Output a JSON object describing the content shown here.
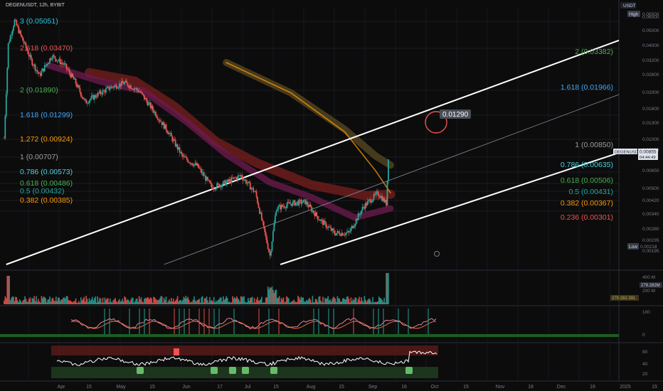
{
  "header": {
    "symbol_line": "DEGENUSDT, 12h, BYBIT",
    "currency": "USDT"
  },
  "price_scale": {
    "high_tag": "High",
    "high_value": "0.06500",
    "low_tag": "Low",
    "low_value": "0.00218",
    "current_symbol": "DEGENUSDT",
    "current_value": "0.00855",
    "countdown": "04:44:49",
    "ticks": [
      "0.06000",
      "0.05000",
      "0.04000",
      "0.03200",
      "0.02600",
      "0.02000",
      "0.01600",
      "0.01300",
      "0.01000",
      "0.00850",
      "0.00650",
      "0.00500",
      "0.00420",
      "0.00340",
      "0.00280",
      "0.00235",
      "0.00195"
    ]
  },
  "volume_scale": {
    "ticks": [
      "400 M",
      "200 M"
    ],
    "current_value": "279.282M",
    "left_value": "279.282.391"
  },
  "osc1_scale": {
    "ticks": [
      "100",
      "0"
    ]
  },
  "osc2_scale": {
    "ticks": [
      "80",
      "40",
      "20"
    ]
  },
  "time_axis": [
    "Apr",
    "15",
    "May",
    "15",
    "Jun",
    "17",
    "Jul",
    "15",
    "Aug",
    "15",
    "Sep",
    "16",
    "Oct",
    "15",
    "Nov",
    "18",
    "Dec",
    "16",
    "2025",
    "15"
  ],
  "fib_left": [
    {
      "label": "3 (0.05051)",
      "color": "#26c6da"
    },
    {
      "label": "2.618 (0.03470)",
      "color": "#ef5350"
    },
    {
      "label": "2 (0.01890)",
      "color": "#4caf50"
    },
    {
      "label": "1.618 (0.01299)",
      "color": "#42a5f5"
    },
    {
      "label": "1.272 (0.00924)",
      "color": "#ff9800"
    },
    {
      "label": "1 (0.00707)",
      "color": "#9e9e9e"
    },
    {
      "label": "0.786 (0.00573)",
      "color": "#4dd0e1"
    },
    {
      "label": "0.618 (0.00486)",
      "color": "#4caf50"
    },
    {
      "label": "0.5 (0.00432)",
      "color": "#26a69a"
    },
    {
      "label": "0.382 (0.00385)",
      "color": "#ff9800"
    }
  ],
  "fib_right": [
    {
      "label": "2 (0.03382)",
      "color": "#4caf50"
    },
    {
      "label": "1.618 (0.01966)",
      "color": "#42a5f5"
    },
    {
      "label": "1 (0.00850)",
      "color": "#9e9e9e"
    },
    {
      "label": "0.786 (0.00635)",
      "color": "#4dd0e1"
    },
    {
      "label": "0.618 (0.00506)",
      "color": "#4caf50"
    },
    {
      "label": "0.5 (0.00431)",
      "color": "#26a69a"
    },
    {
      "label": "0.382 (0.00367)",
      "color": "#ff9800"
    },
    {
      "label": "0.236 (0.00301)",
      "color": "#ef5350"
    }
  ],
  "annotation": {
    "label": "0.01290"
  },
  "chart_data": {
    "type": "candlestick",
    "symbol": "DEGENUSDT",
    "interval": "12h",
    "exchange": "BYBIT",
    "y_scale": "log",
    "ylim": [
      0.00195,
      0.065
    ],
    "x_range": [
      "2024-03-28",
      "2025-01-20"
    ],
    "price_path": [
      {
        "date": "2024-03-30",
        "close": 0.011
      },
      {
        "date": "2024-04-01",
        "close": 0.04
      },
      {
        "date": "2024-04-04",
        "close": 0.055
      },
      {
        "date": "2024-04-08",
        "close": 0.042
      },
      {
        "date": "2024-04-12",
        "close": 0.032
      },
      {
        "date": "2024-04-16",
        "close": 0.026
      },
      {
        "date": "2024-04-22",
        "close": 0.034
      },
      {
        "date": "2024-04-28",
        "close": 0.03
      },
      {
        "date": "2024-05-03",
        "close": 0.024
      },
      {
        "date": "2024-05-08",
        "close": 0.018
      },
      {
        "date": "2024-05-14",
        "close": 0.02
      },
      {
        "date": "2024-05-20",
        "close": 0.022
      },
      {
        "date": "2024-05-27",
        "close": 0.0235
      },
      {
        "date": "2024-06-03",
        "close": 0.021
      },
      {
        "date": "2024-06-10",
        "close": 0.016
      },
      {
        "date": "2024-06-17",
        "close": 0.012
      },
      {
        "date": "2024-06-24",
        "close": 0.0085
      },
      {
        "date": "2024-07-01",
        "close": 0.0075
      },
      {
        "date": "2024-07-08",
        "close": 0.0056
      },
      {
        "date": "2024-07-15",
        "close": 0.006
      },
      {
        "date": "2024-07-22",
        "close": 0.0066
      },
      {
        "date": "2024-07-29",
        "close": 0.0052
      },
      {
        "date": "2024-08-05",
        "close": 0.0022
      },
      {
        "date": "2024-08-08",
        "close": 0.0042
      },
      {
        "date": "2024-08-15",
        "close": 0.0045
      },
      {
        "date": "2024-08-22",
        "close": 0.0046
      },
      {
        "date": "2024-08-29",
        "close": 0.0036
      },
      {
        "date": "2024-09-05",
        "close": 0.003
      },
      {
        "date": "2024-09-12",
        "close": 0.003
      },
      {
        "date": "2024-09-19",
        "close": 0.0043
      },
      {
        "date": "2024-09-26",
        "close": 0.0052
      },
      {
        "date": "2024-09-30",
        "close": 0.0045
      },
      {
        "date": "2024-10-01",
        "close": 0.00855
      }
    ],
    "latest_close": 0.00855,
    "high": 0.065,
    "low": 0.00218,
    "channel": {
      "upper": [
        {
          "date": "2024-03-31",
          "price": 0.00195
        },
        {
          "date": "2025-01-20",
          "price": 0.042
        }
      ],
      "middle": [
        {
          "date": "2024-06-15",
          "price": 0.00195
        },
        {
          "date": "2025-01-20",
          "price": 0.02
        }
      ],
      "lower": [
        {
          "date": "2024-08-10",
          "price": 0.00195
        },
        {
          "date": "2025-01-20",
          "price": 0.009
        }
      ]
    },
    "volume_scale_max": 400000000,
    "latest_volume": 279282391,
    "osc1_range": [
      0,
      100
    ],
    "osc2_range": [
      20,
      80
    ]
  }
}
